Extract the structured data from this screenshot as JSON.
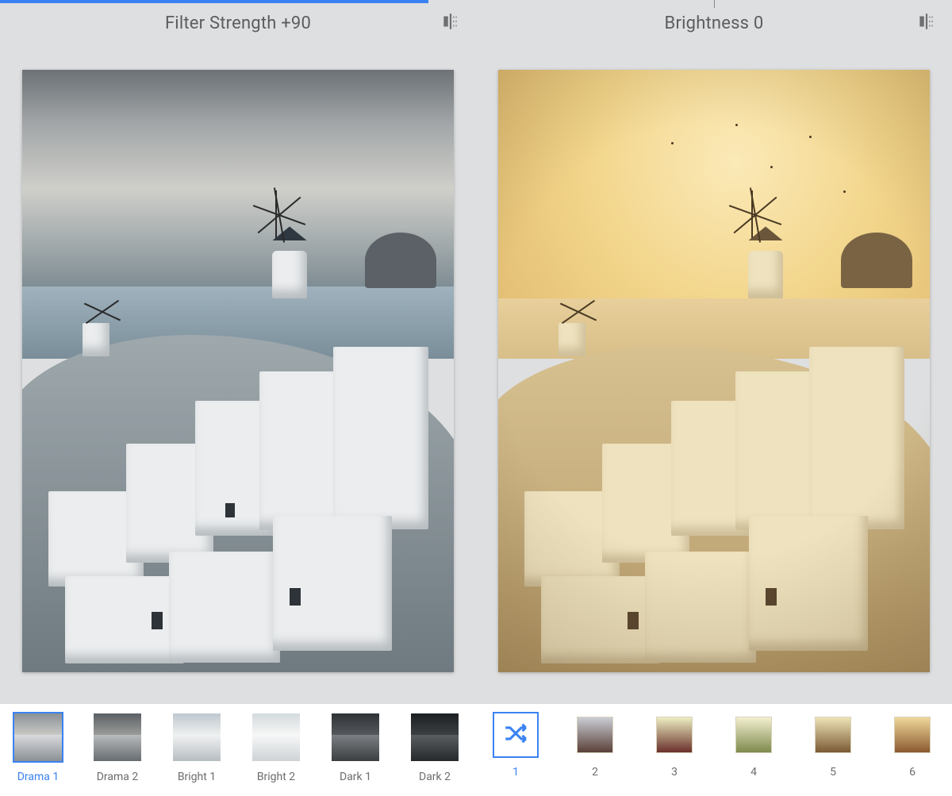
{
  "panes": [
    {
      "slider_value": 90,
      "header_label": "Filter Strength +90",
      "compare_icon": "compare-icon",
      "filters": [
        {
          "label": "Drama 1",
          "selected": true
        },
        {
          "label": "Drama 2",
          "selected": false
        },
        {
          "label": "Bright 1",
          "selected": false
        },
        {
          "label": "Bright 2",
          "selected": false
        },
        {
          "label": "Dark 1",
          "selected": false
        },
        {
          "label": "Dark 2",
          "selected": false
        }
      ]
    },
    {
      "slider_value": 0,
      "header_label": "Brightness 0",
      "compare_icon": "compare-icon",
      "presets": [
        {
          "label": "1",
          "selected": true,
          "kind": "shuffle"
        },
        {
          "label": "2",
          "selected": false,
          "grad": [
            "#c9cdd4",
            "#5b4038"
          ]
        },
        {
          "label": "3",
          "selected": false,
          "grad": [
            "#eceec2",
            "#6a2f2a"
          ]
        },
        {
          "label": "4",
          "selected": false,
          "grad": [
            "#f3efcf",
            "#7e8a4d"
          ]
        },
        {
          "label": "5",
          "selected": false,
          "grad": [
            "#efe3b7",
            "#7a5a34"
          ]
        },
        {
          "label": "6",
          "selected": false,
          "grad": [
            "#f0d79a",
            "#8a5a2f"
          ]
        }
      ]
    }
  ],
  "accent_color": "#3a82f3"
}
